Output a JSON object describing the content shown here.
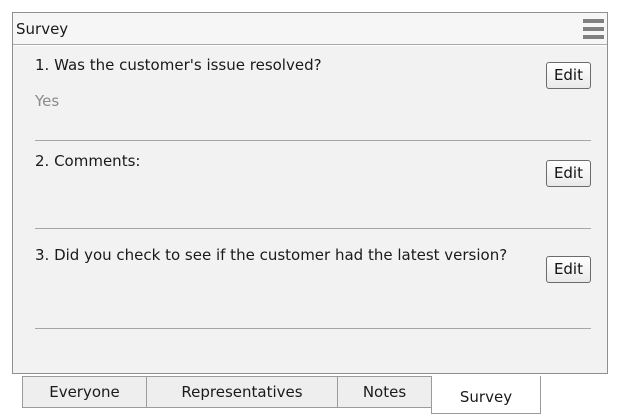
{
  "panel": {
    "title": "Survey",
    "menu_icon": "hamburger-menu-icon"
  },
  "questions": [
    {
      "text": "1. Was the customer's issue resolved?",
      "answer": "Yes",
      "edit_label": "Edit"
    },
    {
      "text": "2. Comments:",
      "answer": "",
      "edit_label": "Edit"
    },
    {
      "text": "3. Did you check to see if the customer had the latest version?",
      "answer": "",
      "edit_label": "Edit"
    }
  ],
  "tabs": [
    {
      "label": "Everyone",
      "active": false
    },
    {
      "label": "Representatives",
      "active": false
    },
    {
      "label": "Notes",
      "active": false
    },
    {
      "label": "Survey",
      "active": true
    }
  ]
}
